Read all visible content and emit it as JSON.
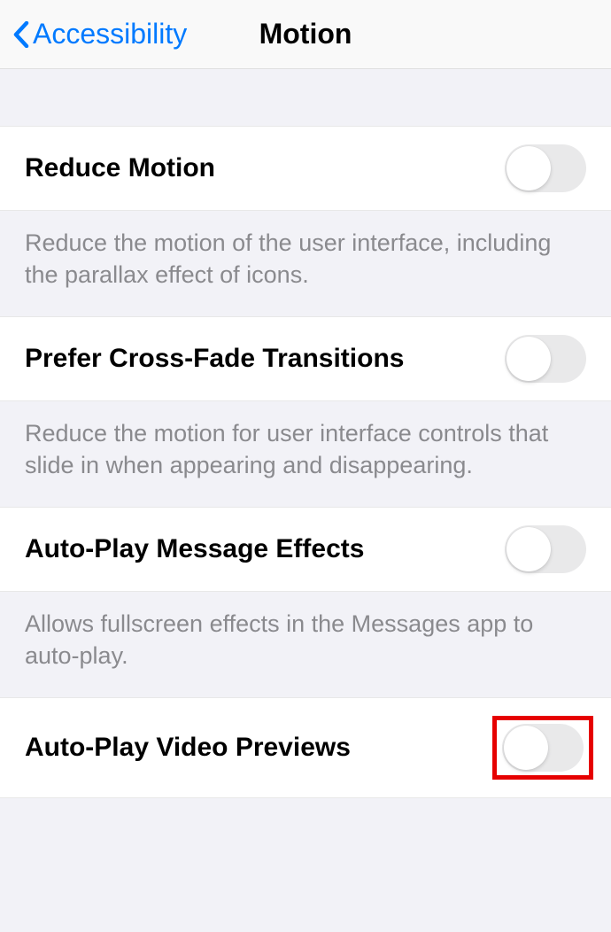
{
  "header": {
    "back_label": "Accessibility",
    "title": "Motion"
  },
  "rows": {
    "reduce_motion": {
      "label": "Reduce Motion",
      "description": "Reduce the motion of the user interface, including the parallax effect of icons."
    },
    "cross_fade": {
      "label": "Prefer Cross-Fade Transitions",
      "description": "Reduce the motion for user interface controls that slide in when appearing and disappearing."
    },
    "auto_play_effects": {
      "label": "Auto-Play Message Effects",
      "description": "Allows fullscreen effects in the Messages app to auto-play."
    },
    "auto_play_video": {
      "label": "Auto-Play Video Previews"
    }
  }
}
